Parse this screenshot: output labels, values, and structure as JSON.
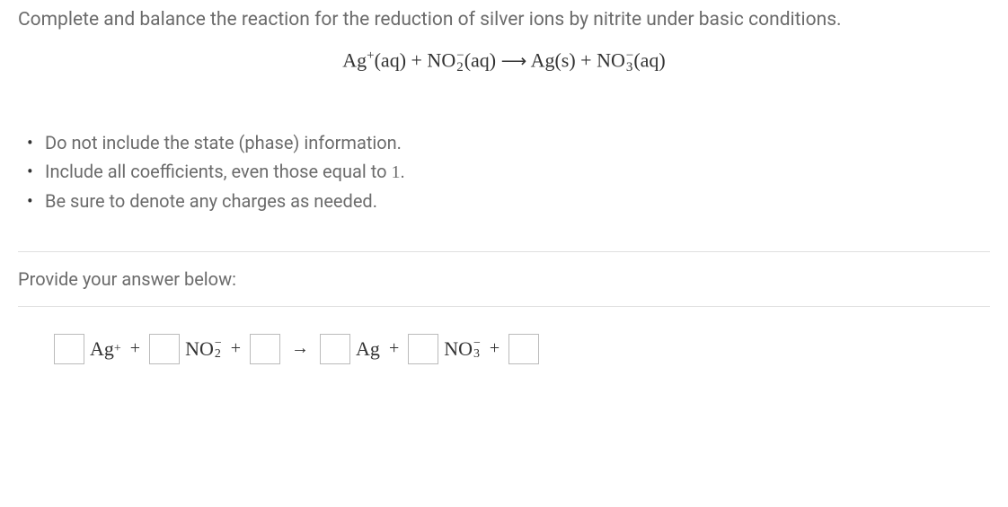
{
  "prompt": "Complete and balance the reaction for the reduction of silver ions by nitrite under basic conditions.",
  "equation_display": "Ag⁺(aq) + NO₂⁻(aq) → Ag(s) + NO₃⁻(aq)",
  "instructions": [
    "Do not include the state (phase) information.",
    "Include all coefficients, even those equal to 1.",
    "Be sure to denote any charges as needed."
  ],
  "answer_label": "Provide your answer below:",
  "answer_row": {
    "inputs": [
      "",
      "",
      "",
      "",
      "",
      ""
    ],
    "species": {
      "ag_plus": "Ag⁺",
      "no2_minus": "NO₂⁻",
      "ag": "Ag",
      "no3_minus": "NO₃⁻"
    },
    "operators": {
      "plus": "+",
      "arrow": "→"
    }
  }
}
